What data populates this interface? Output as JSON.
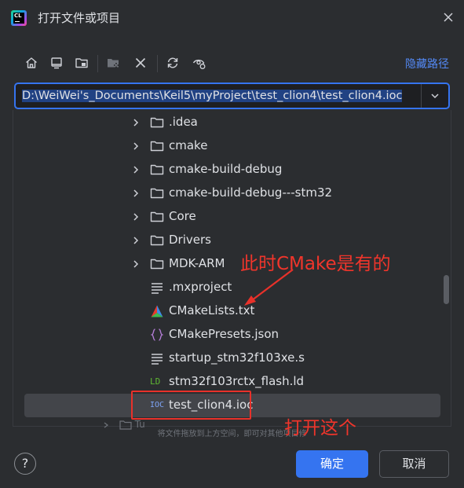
{
  "window": {
    "title": "打开文件或项目",
    "logo_text": "CL"
  },
  "toolbar": {
    "hide_path_label": "隐藏路径"
  },
  "path": {
    "value": "D:\\WeiWei's_Documents\\Keil5\\myProject\\test_clion4\\test_clion4.ioc"
  },
  "tree": {
    "items": [
      {
        "label": ".idea",
        "type": "folder"
      },
      {
        "label": "cmake",
        "type": "folder"
      },
      {
        "label": "cmake-build-debug",
        "type": "folder"
      },
      {
        "label": "cmake-build-debug---stm32",
        "type": "folder"
      },
      {
        "label": "Core",
        "type": "folder"
      },
      {
        "label": "Drivers",
        "type": "folder"
      },
      {
        "label": "MDK-ARM",
        "type": "folder"
      },
      {
        "label": ".mxproject",
        "type": "text-file"
      },
      {
        "label": "CMakeLists.txt",
        "type": "cmake-file"
      },
      {
        "label": "CMakePresets.json",
        "type": "json-file"
      },
      {
        "label": "startup_stm32f103xe.s",
        "type": "text-file"
      },
      {
        "label": "stm32f103rctx_flash.ld",
        "type": "ld-file",
        "icon_text": "LD"
      },
      {
        "label": "test_clion4.ioc",
        "type": "ioc-file",
        "icon_text": "IOC",
        "selected": true
      }
    ],
    "partial_item": "Tu",
    "drop_hint": "将文件拖放到上方空间，即可对其他项目修"
  },
  "annotations": {
    "cmake_note": "此时CMake是有的",
    "open_note": "打开这个",
    "color": "#f0352b"
  },
  "buttons": {
    "ok": "确定",
    "cancel": "取消",
    "help": "?"
  },
  "colors": {
    "accent": "#3574f0",
    "background": "#2b2d30",
    "link": "#548af7"
  }
}
